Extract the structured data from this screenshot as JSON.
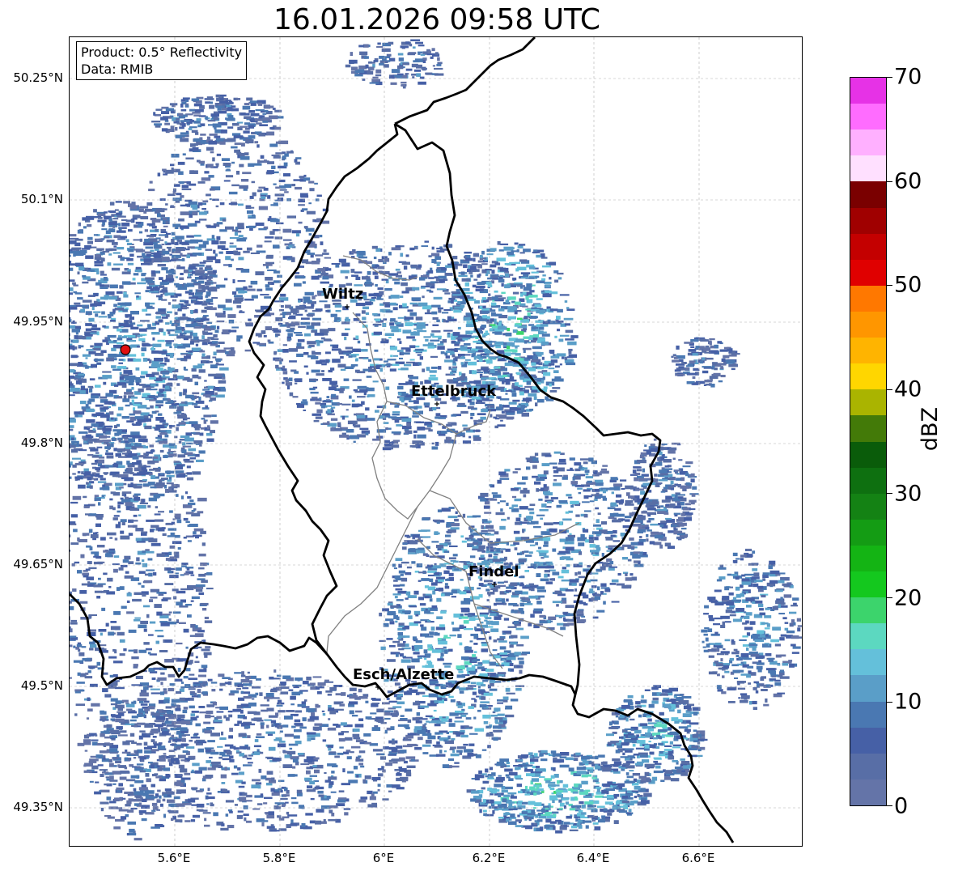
{
  "title": "16.01.2026 09:58 UTC",
  "info": {
    "product": "Product: 0.5° Reflectivity",
    "source": "Data: RMIB"
  },
  "lat_labels": [
    "50.25°N",
    "50.1°N",
    "49.95°N",
    "49.8°N",
    "49.65°N",
    "49.5°N",
    "49.35°N"
  ],
  "lon_labels": [
    "5.6°E",
    "5.8°E",
    "6°E",
    "6.2°E",
    "6.4°E",
    "6.6°E"
  ],
  "colorbar": {
    "unit": "dBZ",
    "ticks": [
      "0",
      "10",
      "20",
      "30",
      "40",
      "50",
      "60",
      "70"
    ],
    "colors": [
      "#6474a8",
      "#586ea6",
      "#4660a6",
      "#4a78b2",
      "#5a9ec8",
      "#64c0da",
      "#5cd8c0",
      "#3cd46c",
      "#14c81e",
      "#14b414",
      "#149c14",
      "#148214",
      "#0e7010",
      "#0a5c0a",
      "#437a08",
      "#aab400",
      "#ffd600",
      "#ffb400",
      "#ff9600",
      "#ff7800",
      "#e00000",
      "#c40000",
      "#a00000",
      "#7a0000",
      "#ffe0ff",
      "#ffb0ff",
      "#ff6cff",
      "#e632e6"
    ]
  },
  "cities": [
    {
      "name": "Wiltz"
    },
    {
      "name": "Ettelbruck"
    },
    {
      "name": "Findel"
    },
    {
      "name": "Esch/Alzette"
    }
  ],
  "radar_site": {
    "color": "#e01010"
  }
}
